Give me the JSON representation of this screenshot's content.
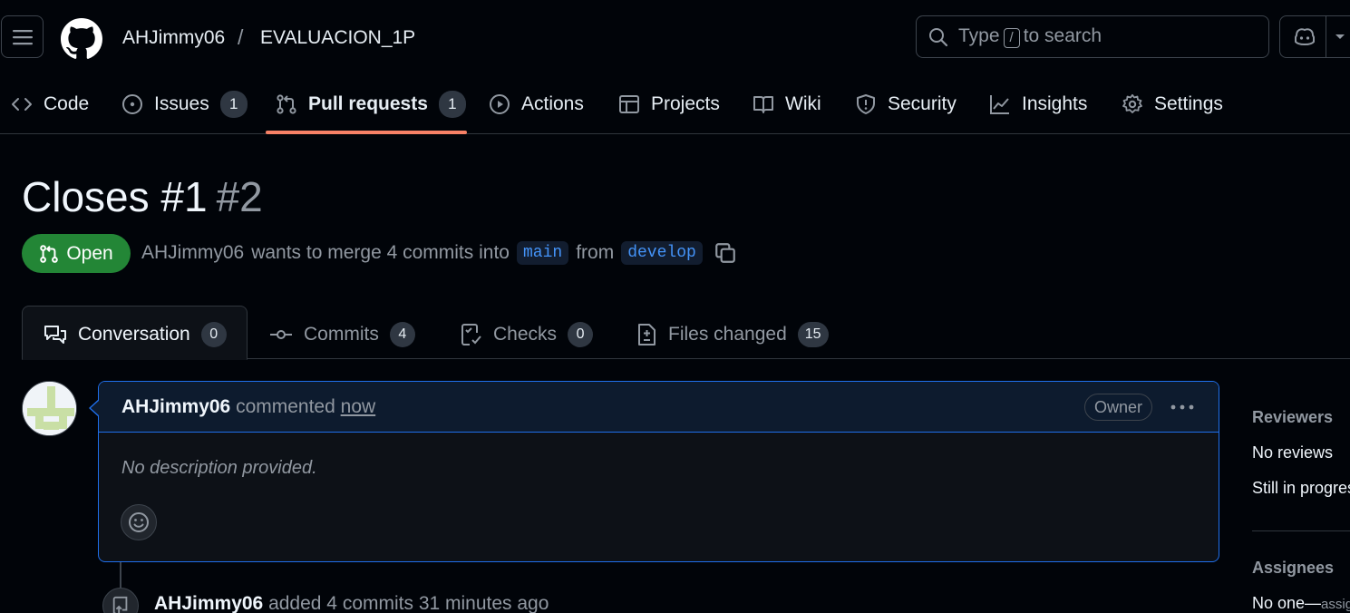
{
  "header": {
    "owner": "AHJimmy06",
    "separator": "/",
    "repo": "EVALUACION_1P",
    "search_prefix": "Type",
    "search_key": "/",
    "search_suffix": "to search"
  },
  "repo_nav": {
    "tabs": [
      {
        "label": "Code",
        "icon": "code-icon"
      },
      {
        "label": "Issues",
        "icon": "issue-opened-icon",
        "count": "1"
      },
      {
        "label": "Pull requests",
        "icon": "git-pull-request-icon",
        "count": "1",
        "active": true
      },
      {
        "label": "Actions",
        "icon": "play-icon"
      },
      {
        "label": "Projects",
        "icon": "table-icon"
      },
      {
        "label": "Wiki",
        "icon": "book-icon"
      },
      {
        "label": "Security",
        "icon": "shield-icon"
      },
      {
        "label": "Insights",
        "icon": "graph-icon"
      },
      {
        "label": "Settings",
        "icon": "gear-icon"
      }
    ]
  },
  "pr": {
    "title": "Closes #1",
    "number": "#2",
    "state": "Open",
    "author": "AHJimmy06",
    "merge_text": "wants to merge 4 commits into",
    "base_branch": "main",
    "from_text": "from",
    "head_branch": "develop"
  },
  "pr_tabs": [
    {
      "label": "Conversation",
      "count": "0",
      "icon": "comment-discussion-icon",
      "active": true
    },
    {
      "label": "Commits",
      "count": "4",
      "icon": "git-commit-icon"
    },
    {
      "label": "Checks",
      "count": "0",
      "icon": "checklist-icon"
    },
    {
      "label": "Files changed",
      "count": "15",
      "icon": "file-diff-icon"
    }
  ],
  "comment": {
    "author": "AHJimmy06",
    "verb": "commented",
    "time": "now",
    "role_badge": "Owner",
    "body": "No description provided."
  },
  "timeline": {
    "author": "AHJimmy06",
    "text": "added 4 commits 31 minutes ago"
  },
  "sidebar": {
    "reviewers_heading": "Reviewers",
    "reviewers_value": "No reviews",
    "reviewers_status": "Still in progress?",
    "assignees_heading": "Assignees",
    "assignees_value": "No one—",
    "assignees_link": "assign yourself"
  },
  "colors": {
    "accent_underline": "#f78166",
    "open_state": "#238636",
    "link": "#4493f8",
    "comment_border": "#1f6feb"
  }
}
